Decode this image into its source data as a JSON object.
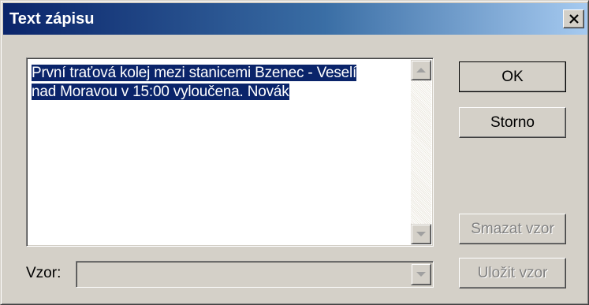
{
  "window": {
    "title": "Text zápisu",
    "close_label": "×"
  },
  "memo": {
    "line1": "První traťová kolej mezi stanicemi Bzenec - Veselí",
    "line2": "nad Moravou v 15:00 vyloučena. Novák"
  },
  "pattern": {
    "label": "Vzor:",
    "value": ""
  },
  "buttons": {
    "ok": "OK",
    "storno": "Storno",
    "smazat": "Smazat vzor",
    "ulozit": "Uložit vzor"
  },
  "colors": {
    "selection": "#0a246a",
    "face": "#d4d0c8",
    "disabled_text": "#808080"
  }
}
